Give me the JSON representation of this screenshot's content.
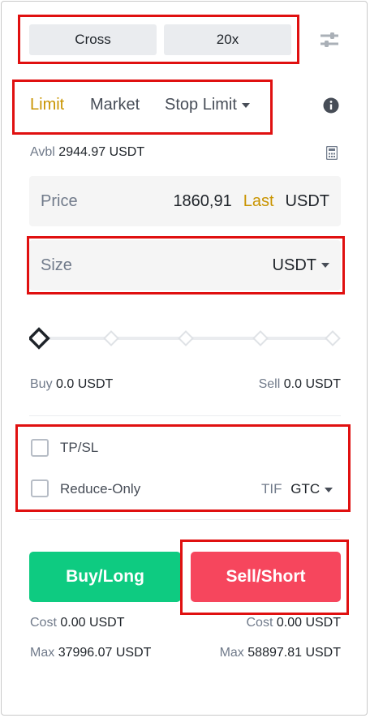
{
  "margin_mode": {
    "mode": "Cross",
    "leverage": "20x"
  },
  "order_tabs": [
    {
      "label": "Limit",
      "active": true
    },
    {
      "label": "Market",
      "active": false
    },
    {
      "label": "Stop Limit",
      "active": false
    }
  ],
  "available": {
    "label": "Avbl",
    "value": "2944.97 USDT"
  },
  "price_field": {
    "label": "Price",
    "value": "1860,91",
    "last_label": "Last",
    "unit": "USDT"
  },
  "size_field": {
    "label": "Size",
    "unit": "USDT"
  },
  "slider": {
    "value_fraction": 0,
    "steps": 5
  },
  "buy_amount": {
    "label": "Buy",
    "value": "0.0 USDT"
  },
  "sell_amount": {
    "label": "Sell",
    "value": "0.0 USDT"
  },
  "options": {
    "tpsl_label": "TP/SL",
    "tpsl_checked": false,
    "reduce_only_label": "Reduce-Only",
    "reduce_only_checked": false,
    "tif_label": "TIF",
    "tif_value": "GTC"
  },
  "buttons": {
    "buy_long": "Buy/Long",
    "sell_short": "Sell/Short"
  },
  "buy_cost": {
    "label": "Cost",
    "value": "0.00 USDT"
  },
  "sell_cost": {
    "label": "Cost",
    "value": "0.00 USDT"
  },
  "buy_max": {
    "label": "Max",
    "value": "37996.07 USDT"
  },
  "sell_max": {
    "label": "Max",
    "value": "58897.81 USDT"
  },
  "colors": {
    "accent": "#c99400",
    "buy": "#0ecb81",
    "sell": "#f6465d",
    "highlight": "#e01010"
  },
  "icons": [
    "settings-sliders-icon",
    "info-icon",
    "calculator-icon"
  ]
}
